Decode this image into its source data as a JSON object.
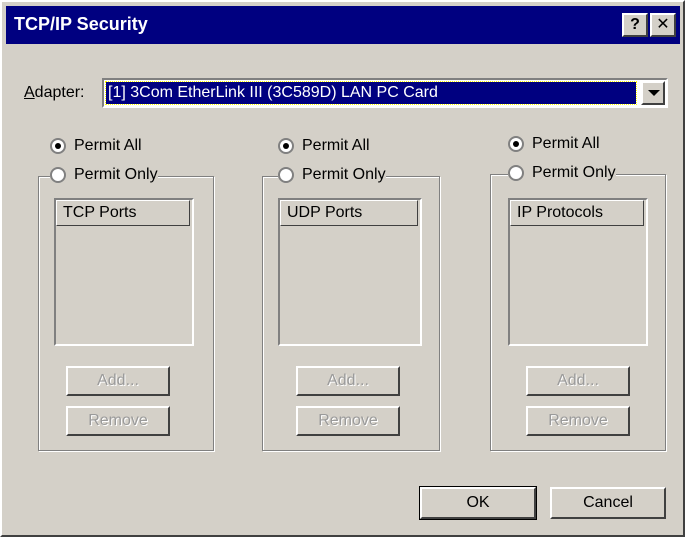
{
  "window": {
    "title": "TCP/IP Security",
    "help_glyph": "?",
    "close_glyph": "✕"
  },
  "adapter": {
    "label": "Adapter:",
    "label_accel": "A",
    "label_rest": "dapter:",
    "selected": "[1] 3Com EtherLink III (3C589D) LAN PC Card"
  },
  "groups": [
    {
      "permit_all": "Permit All",
      "permit_only": "Permit Only",
      "permit_all_selected": true,
      "list_header": "TCP Ports",
      "add_label": "Add...",
      "remove_label": "Remove"
    },
    {
      "permit_all": "Permit All",
      "permit_only": "Permit Only",
      "permit_all_selected": true,
      "list_header": "UDP Ports",
      "add_label": "Add...",
      "remove_label": "Remove"
    },
    {
      "permit_all": "Permit All",
      "permit_only": "Permit Only",
      "permit_all_selected": true,
      "list_header": "IP Protocols",
      "add_label": "Add...",
      "remove_label": "Remove"
    }
  ],
  "buttons": {
    "ok": "OK",
    "cancel": "Cancel"
  }
}
